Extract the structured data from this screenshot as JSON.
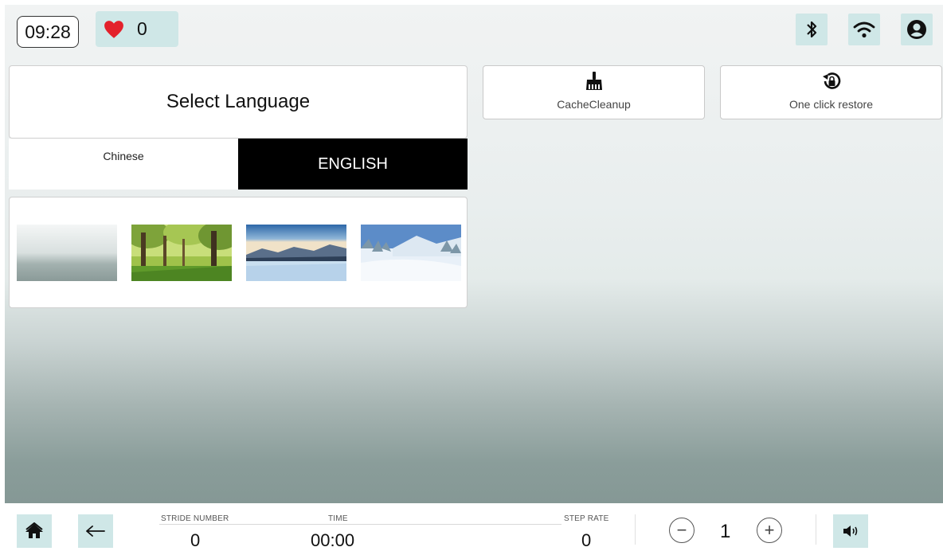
{
  "status_bar": {
    "time": "09:28",
    "heart_rate": "0",
    "icons": [
      "bluetooth-icon",
      "wifi-icon",
      "user-icon"
    ]
  },
  "language": {
    "title": "Select Language",
    "options": [
      "Chinese",
      "ENGLISH"
    ],
    "selected": "ENGLISH"
  },
  "backgrounds": {
    "thumbnails": [
      "plain-gradient",
      "forest",
      "mountain-lake",
      "snowy-forest"
    ]
  },
  "actions": {
    "cache_cleanup": "CacheCleanup",
    "restore": "One click restore"
  },
  "bottom_bar": {
    "stride_label": "STRIDE NUMBER",
    "stride_value": "0",
    "time_label": "TIME",
    "time_value": "00:00",
    "step_rate_label": "STEP RATE",
    "step_rate_value": "0",
    "level_value": "1",
    "minus": "−",
    "plus": "+"
  },
  "colors": {
    "accent_tile": "#cfe7e7",
    "heart": "#e3212b",
    "selected_bg": "#000000"
  }
}
